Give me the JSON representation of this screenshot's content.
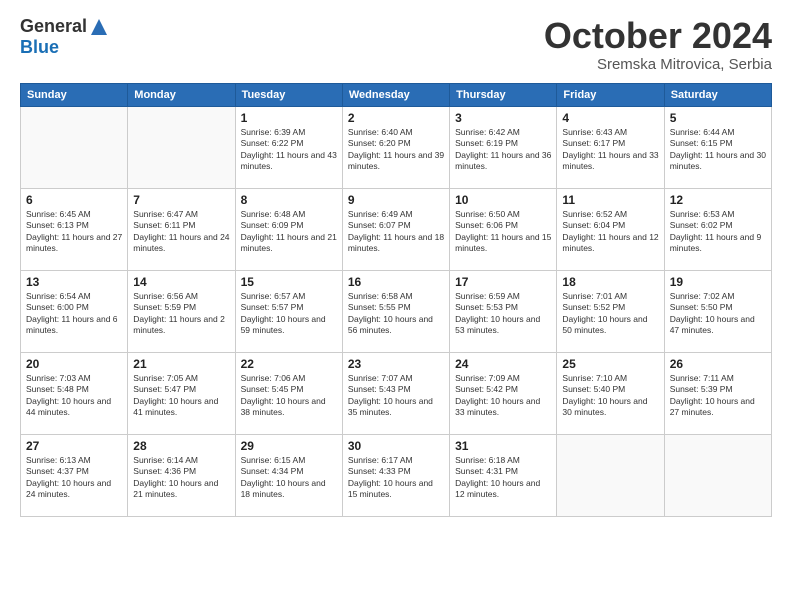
{
  "header": {
    "logo_general": "General",
    "logo_blue": "Blue",
    "month_title": "October 2024",
    "subtitle": "Sremska Mitrovica, Serbia"
  },
  "days_of_week": [
    "Sunday",
    "Monday",
    "Tuesday",
    "Wednesday",
    "Thursday",
    "Friday",
    "Saturday"
  ],
  "weeks": [
    [
      {
        "day": "",
        "sunrise": "",
        "sunset": "",
        "daylight": ""
      },
      {
        "day": "",
        "sunrise": "",
        "sunset": "",
        "daylight": ""
      },
      {
        "day": "1",
        "sunrise": "Sunrise: 6:39 AM",
        "sunset": "Sunset: 6:22 PM",
        "daylight": "Daylight: 11 hours and 43 minutes."
      },
      {
        "day": "2",
        "sunrise": "Sunrise: 6:40 AM",
        "sunset": "Sunset: 6:20 PM",
        "daylight": "Daylight: 11 hours and 39 minutes."
      },
      {
        "day": "3",
        "sunrise": "Sunrise: 6:42 AM",
        "sunset": "Sunset: 6:19 PM",
        "daylight": "Daylight: 11 hours and 36 minutes."
      },
      {
        "day": "4",
        "sunrise": "Sunrise: 6:43 AM",
        "sunset": "Sunset: 6:17 PM",
        "daylight": "Daylight: 11 hours and 33 minutes."
      },
      {
        "day": "5",
        "sunrise": "Sunrise: 6:44 AM",
        "sunset": "Sunset: 6:15 PM",
        "daylight": "Daylight: 11 hours and 30 minutes."
      }
    ],
    [
      {
        "day": "6",
        "sunrise": "Sunrise: 6:45 AM",
        "sunset": "Sunset: 6:13 PM",
        "daylight": "Daylight: 11 hours and 27 minutes."
      },
      {
        "day": "7",
        "sunrise": "Sunrise: 6:47 AM",
        "sunset": "Sunset: 6:11 PM",
        "daylight": "Daylight: 11 hours and 24 minutes."
      },
      {
        "day": "8",
        "sunrise": "Sunrise: 6:48 AM",
        "sunset": "Sunset: 6:09 PM",
        "daylight": "Daylight: 11 hours and 21 minutes."
      },
      {
        "day": "9",
        "sunrise": "Sunrise: 6:49 AM",
        "sunset": "Sunset: 6:07 PM",
        "daylight": "Daylight: 11 hours and 18 minutes."
      },
      {
        "day": "10",
        "sunrise": "Sunrise: 6:50 AM",
        "sunset": "Sunset: 6:06 PM",
        "daylight": "Daylight: 11 hours and 15 minutes."
      },
      {
        "day": "11",
        "sunrise": "Sunrise: 6:52 AM",
        "sunset": "Sunset: 6:04 PM",
        "daylight": "Daylight: 11 hours and 12 minutes."
      },
      {
        "day": "12",
        "sunrise": "Sunrise: 6:53 AM",
        "sunset": "Sunset: 6:02 PM",
        "daylight": "Daylight: 11 hours and 9 minutes."
      }
    ],
    [
      {
        "day": "13",
        "sunrise": "Sunrise: 6:54 AM",
        "sunset": "Sunset: 6:00 PM",
        "daylight": "Daylight: 11 hours and 6 minutes."
      },
      {
        "day": "14",
        "sunrise": "Sunrise: 6:56 AM",
        "sunset": "Sunset: 5:59 PM",
        "daylight": "Daylight: 11 hours and 2 minutes."
      },
      {
        "day": "15",
        "sunrise": "Sunrise: 6:57 AM",
        "sunset": "Sunset: 5:57 PM",
        "daylight": "Daylight: 10 hours and 59 minutes."
      },
      {
        "day": "16",
        "sunrise": "Sunrise: 6:58 AM",
        "sunset": "Sunset: 5:55 PM",
        "daylight": "Daylight: 10 hours and 56 minutes."
      },
      {
        "day": "17",
        "sunrise": "Sunrise: 6:59 AM",
        "sunset": "Sunset: 5:53 PM",
        "daylight": "Daylight: 10 hours and 53 minutes."
      },
      {
        "day": "18",
        "sunrise": "Sunrise: 7:01 AM",
        "sunset": "Sunset: 5:52 PM",
        "daylight": "Daylight: 10 hours and 50 minutes."
      },
      {
        "day": "19",
        "sunrise": "Sunrise: 7:02 AM",
        "sunset": "Sunset: 5:50 PM",
        "daylight": "Daylight: 10 hours and 47 minutes."
      }
    ],
    [
      {
        "day": "20",
        "sunrise": "Sunrise: 7:03 AM",
        "sunset": "Sunset: 5:48 PM",
        "daylight": "Daylight: 10 hours and 44 minutes."
      },
      {
        "day": "21",
        "sunrise": "Sunrise: 7:05 AM",
        "sunset": "Sunset: 5:47 PM",
        "daylight": "Daylight: 10 hours and 41 minutes."
      },
      {
        "day": "22",
        "sunrise": "Sunrise: 7:06 AM",
        "sunset": "Sunset: 5:45 PM",
        "daylight": "Daylight: 10 hours and 38 minutes."
      },
      {
        "day": "23",
        "sunrise": "Sunrise: 7:07 AM",
        "sunset": "Sunset: 5:43 PM",
        "daylight": "Daylight: 10 hours and 35 minutes."
      },
      {
        "day": "24",
        "sunrise": "Sunrise: 7:09 AM",
        "sunset": "Sunset: 5:42 PM",
        "daylight": "Daylight: 10 hours and 33 minutes."
      },
      {
        "day": "25",
        "sunrise": "Sunrise: 7:10 AM",
        "sunset": "Sunset: 5:40 PM",
        "daylight": "Daylight: 10 hours and 30 minutes."
      },
      {
        "day": "26",
        "sunrise": "Sunrise: 7:11 AM",
        "sunset": "Sunset: 5:39 PM",
        "daylight": "Daylight: 10 hours and 27 minutes."
      }
    ],
    [
      {
        "day": "27",
        "sunrise": "Sunrise: 6:13 AM",
        "sunset": "Sunset: 4:37 PM",
        "daylight": "Daylight: 10 hours and 24 minutes."
      },
      {
        "day": "28",
        "sunrise": "Sunrise: 6:14 AM",
        "sunset": "Sunset: 4:36 PM",
        "daylight": "Daylight: 10 hours and 21 minutes."
      },
      {
        "day": "29",
        "sunrise": "Sunrise: 6:15 AM",
        "sunset": "Sunset: 4:34 PM",
        "daylight": "Daylight: 10 hours and 18 minutes."
      },
      {
        "day": "30",
        "sunrise": "Sunrise: 6:17 AM",
        "sunset": "Sunset: 4:33 PM",
        "daylight": "Daylight: 10 hours and 15 minutes."
      },
      {
        "day": "31",
        "sunrise": "Sunrise: 6:18 AM",
        "sunset": "Sunset: 4:31 PM",
        "daylight": "Daylight: 10 hours and 12 minutes."
      },
      {
        "day": "",
        "sunrise": "",
        "sunset": "",
        "daylight": ""
      },
      {
        "day": "",
        "sunrise": "",
        "sunset": "",
        "daylight": ""
      }
    ]
  ]
}
